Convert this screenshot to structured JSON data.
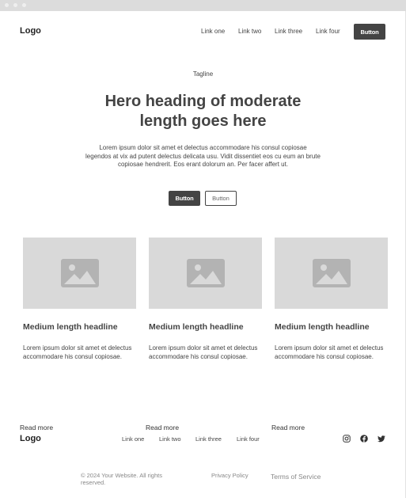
{
  "header": {
    "logo": "Logo",
    "nav": [
      "Link one",
      "Link two",
      "Link three",
      "Link four"
    ],
    "cta": "Button"
  },
  "hero": {
    "tagline": "Tagline",
    "heading": "Hero heading of moderate length goes here",
    "body": "Lorem ipsum dolor sit amet et delectus accommodare his consul copiosae legendos at vix ad putent delectus delicata usu. Vidit dissentiet eos cu eum an brute copiosae hendrerit. Eos erant dolorum an. Per facer affert ut.",
    "primary_button": "Button",
    "secondary_button": "Button"
  },
  "cards": [
    {
      "image_icon": "image-placeholder-icon",
      "title": "Medium length headline",
      "body": "Lorem ipsum dolor sit amet et delectus accommodare his consul copiosae.",
      "link": "Read more"
    },
    {
      "image_icon": "image-placeholder-icon",
      "title": "Medium length headline",
      "body": "Lorem ipsum dolor sit amet et delectus accommodare his consul copiosae.",
      "link": "Read more"
    },
    {
      "image_icon": "image-placeholder-icon",
      "title": "Medium length headline",
      "body": "Lorem ipsum dolor sit amet et delectus accommodare his consul copiosae.",
      "link": "Read more"
    }
  ],
  "footer": {
    "logo": "Logo",
    "nav": [
      "Link one",
      "Link two",
      "Link three",
      "Link four"
    ],
    "social_icons": [
      "instagram-icon",
      "facebook-icon",
      "twitter-icon"
    ],
    "copyright": "© 2024 Your Website. All rights reserved.",
    "privacy": "Privacy Policy",
    "terms": "Terms of Service"
  },
  "colors": {
    "dark": "#444444",
    "placeholder": "#d9d9d9",
    "placeholder_icon": "#b3b3b3",
    "muted": "#888888"
  }
}
